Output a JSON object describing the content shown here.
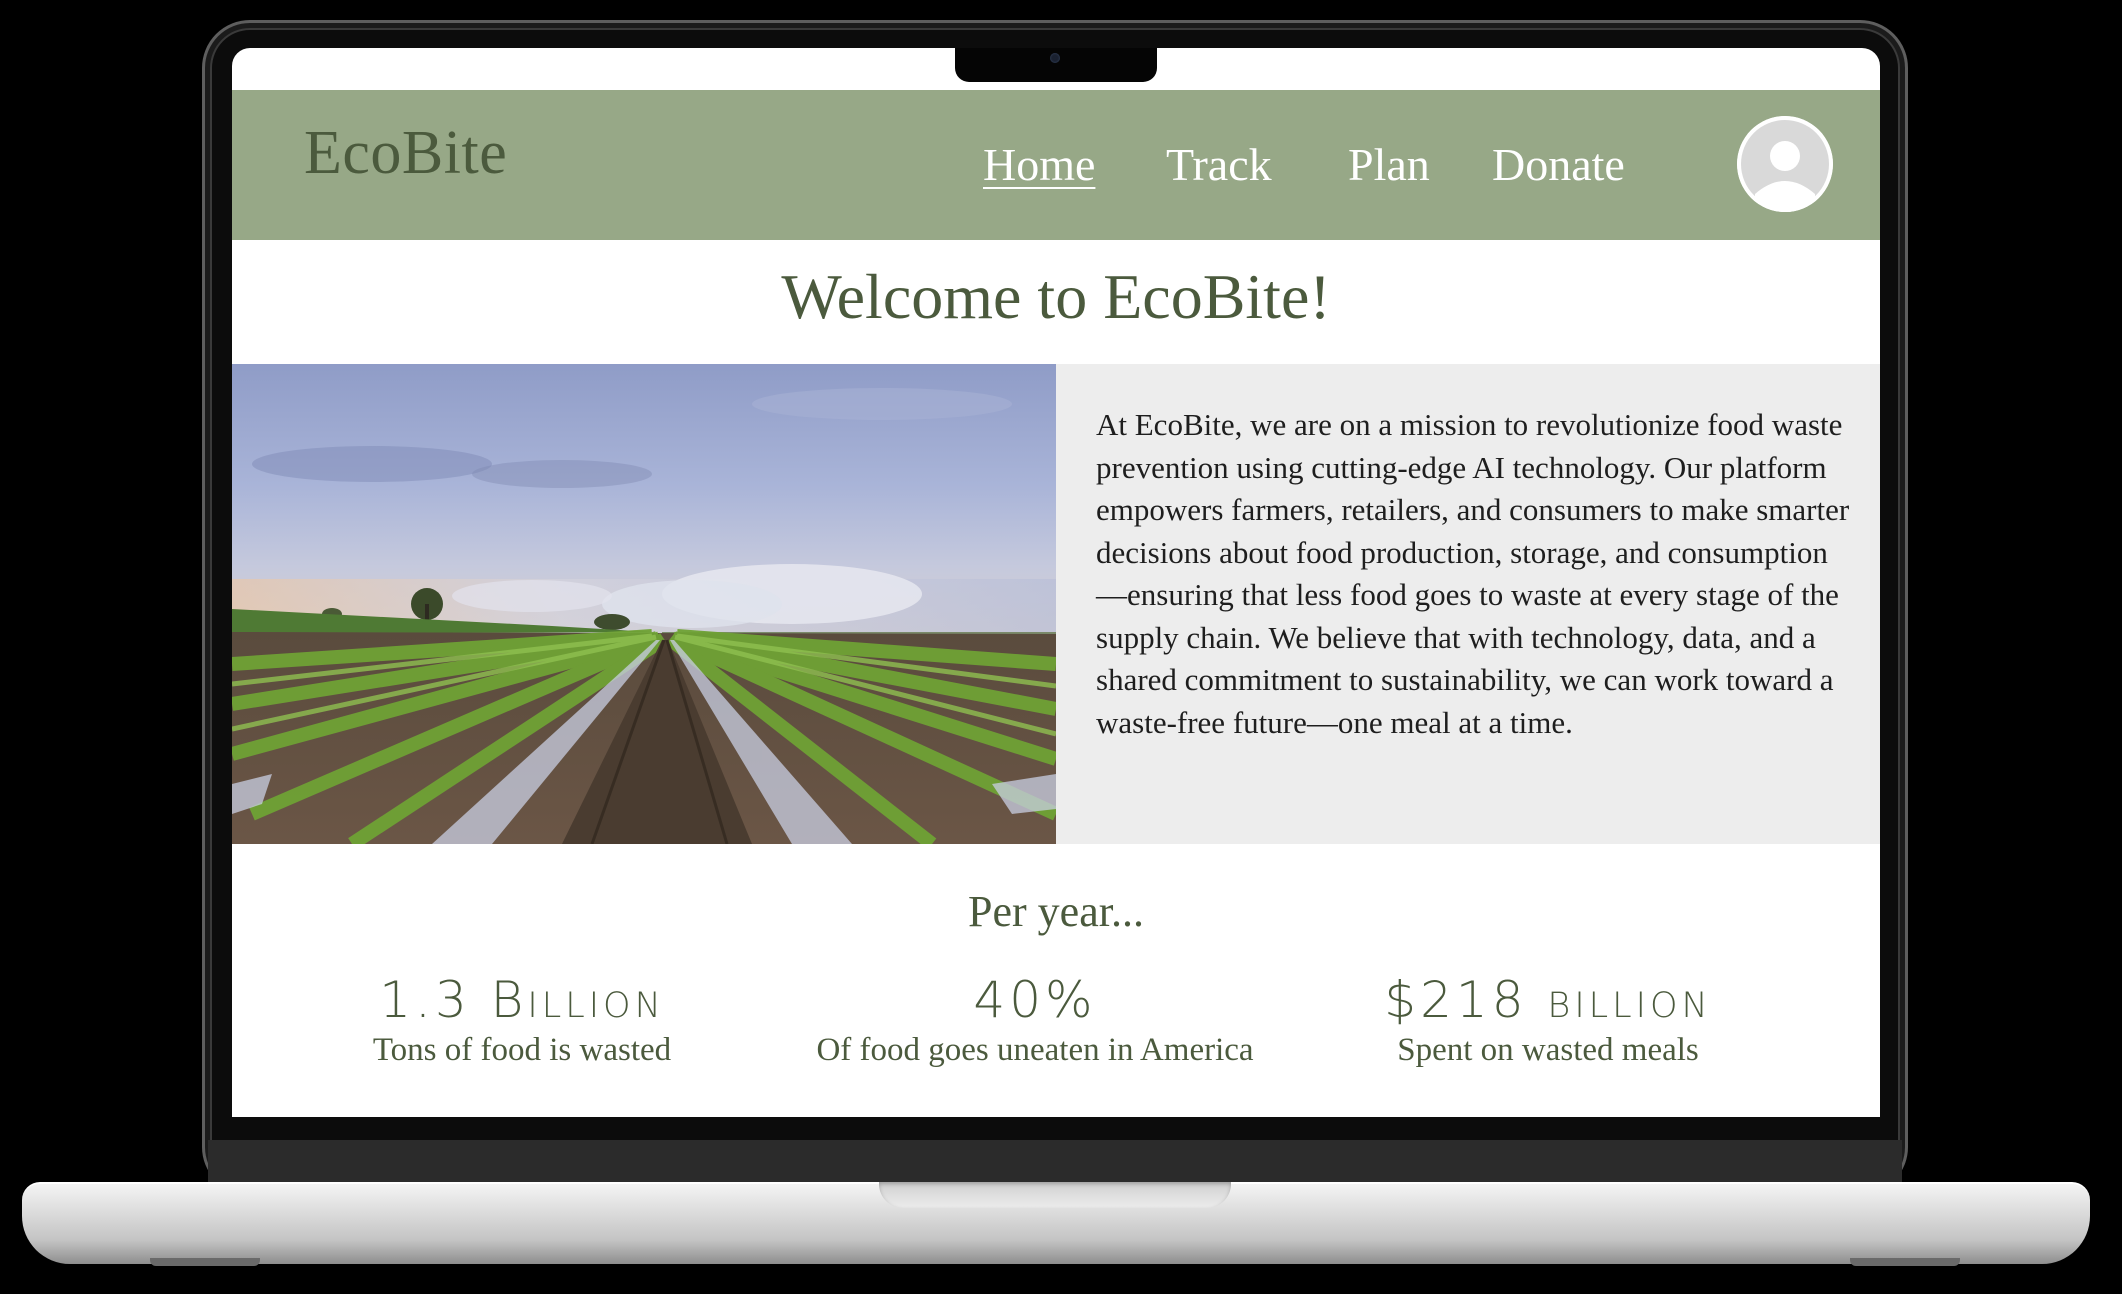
{
  "header": {
    "logo": "EcoBite",
    "nav": [
      {
        "label": "Home",
        "active": true
      },
      {
        "label": "Track",
        "active": false
      },
      {
        "label": "Plan",
        "active": false
      },
      {
        "label": "Donate",
        "active": false
      }
    ],
    "profile_icon": "user-avatar-icon",
    "background": "#97a887"
  },
  "main": {
    "heading": "Welcome to EcoBite!",
    "hero_image": "farm-field-lettuce-rows",
    "intro": "At EcoBite, we are on a mission to revolutionize food waste prevention using cutting-edge AI technology. Our platform empowers farmers, retailers, and consumers to make smarter decisions about food production, storage, and consumption—ensuring that less food goes to waste at every stage of the supply chain. We believe that with technology, data, and a shared commitment to sustainability, we can work toward a waste-free future—one meal at a time."
  },
  "stats": {
    "heading": "Per year...",
    "items": [
      {
        "value": "1.3 Billion",
        "label": "Tons of food is wasted"
      },
      {
        "value": "40%",
        "label": "Of food goes uneaten in America"
      },
      {
        "value": "$218 billion",
        "label": "Spent on wasted meals"
      }
    ]
  },
  "colors": {
    "brand_dark": "#4b5a3d",
    "brand_green": "#97a887",
    "panel_gray": "#ededed"
  }
}
